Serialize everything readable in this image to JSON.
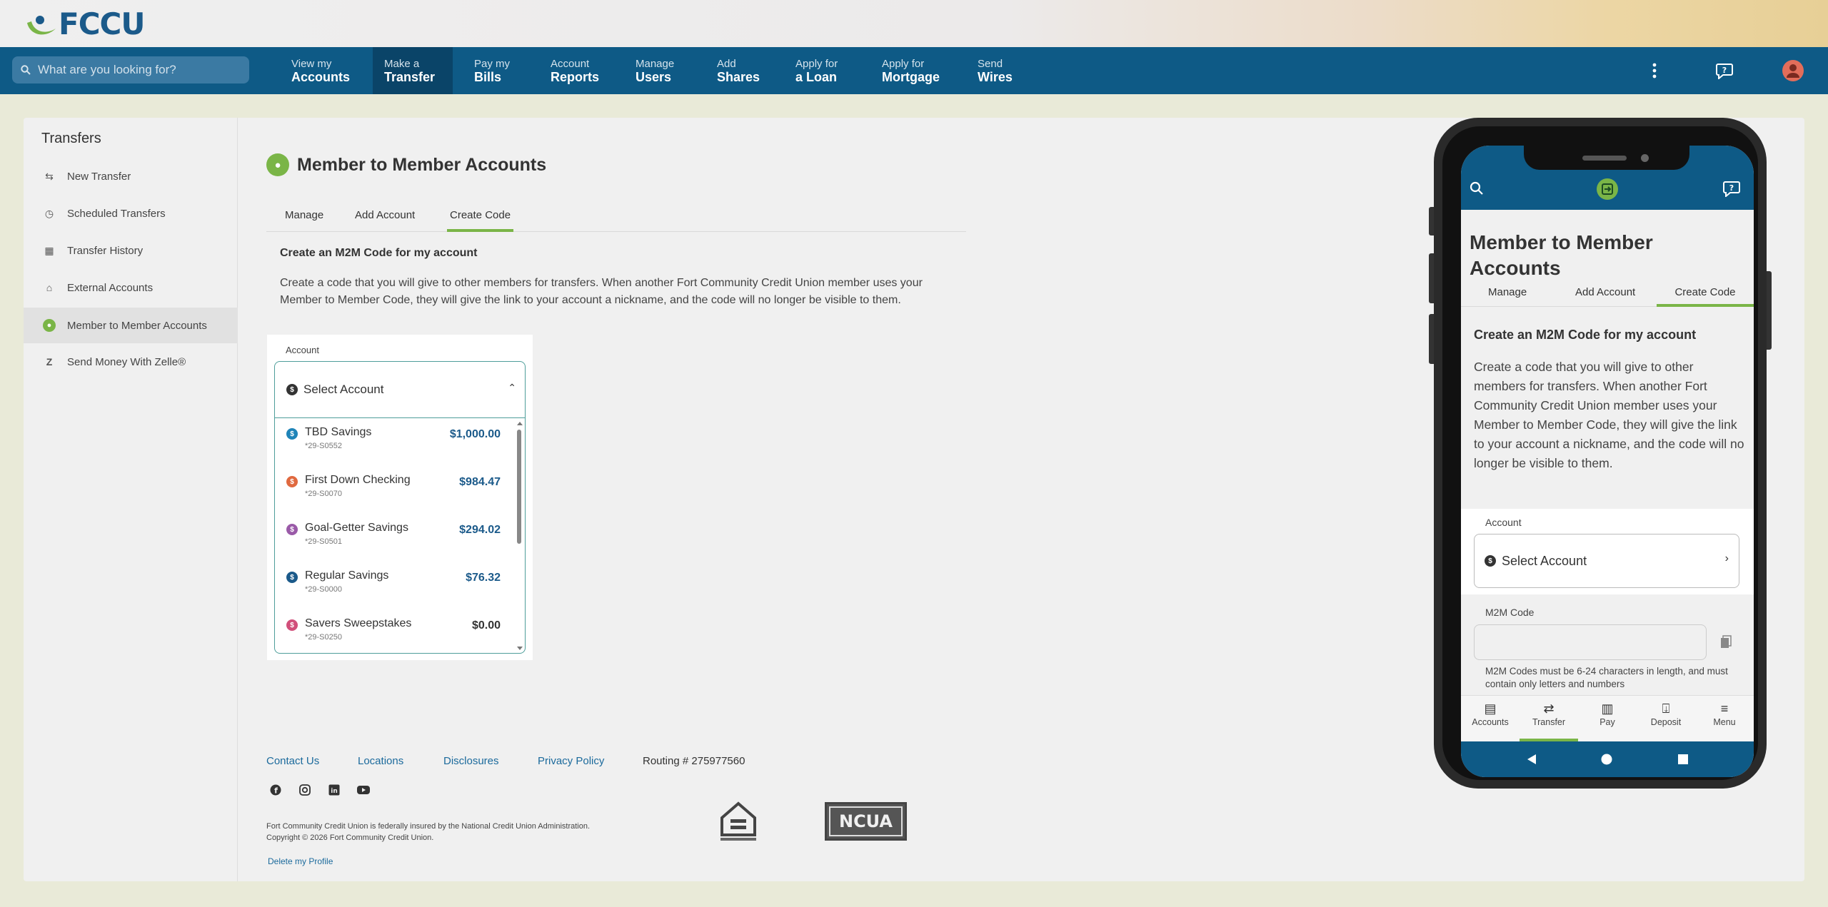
{
  "brand": {
    "name": "FCCU"
  },
  "search": {
    "placeholder": "What are you looking for?"
  },
  "nav": [
    {
      "line1": "View my",
      "line2": "Accounts"
    },
    {
      "line1": "Make a",
      "line2": "Transfer"
    },
    {
      "line1": "Pay my",
      "line2": "Bills"
    },
    {
      "line1": "Account",
      "line2": "Reports"
    },
    {
      "line1": "Manage",
      "line2": "Users"
    },
    {
      "line1": "Add",
      "line2": "Shares"
    },
    {
      "line1": "Apply for",
      "line2": "a Loan"
    },
    {
      "line1": "Apply for",
      "line2": "Mortgage"
    },
    {
      "line1": "Send",
      "line2": "Wires"
    }
  ],
  "sidebar": {
    "title": "Transfers",
    "items": [
      {
        "label": "New Transfer",
        "icon": "arrows-icon"
      },
      {
        "label": "Scheduled Transfers",
        "icon": "clock-icon"
      },
      {
        "label": "Transfer History",
        "icon": "calendar-icon"
      },
      {
        "label": "External Accounts",
        "icon": "bank-icon"
      },
      {
        "label": "Member to Member Accounts",
        "icon": "members-icon"
      },
      {
        "label": "Send Money With Zelle®",
        "icon": "zelle-icon"
      }
    ]
  },
  "page": {
    "title": "Member to Member Accounts",
    "tabs": [
      "Manage",
      "Add Account",
      "Create Code"
    ],
    "section_title": "Create an M2M Code for my account",
    "description": "Create a code that you will give to other members for transfers. When another Fort Community Credit Union member uses your Member to Member Code, they will give the link to your account a nickname, and the code will no longer be visible to them.",
    "account_label": "Account",
    "select_placeholder": "Select Account"
  },
  "accounts": [
    {
      "name": "TBD Savings",
      "number": "*29-S0552",
      "amount": "$1,000.00",
      "color": "#1f84b8"
    },
    {
      "name": "First Down Checking",
      "number": "*29-S0070",
      "amount": "$984.47",
      "color": "#e0693f"
    },
    {
      "name": "Goal-Getter Savings",
      "number": "*29-S0501",
      "amount": "$294.02",
      "color": "#9a5aa8"
    },
    {
      "name": "Regular Savings",
      "number": "*29-S0000",
      "amount": "$76.32",
      "color": "#1b5a8a"
    },
    {
      "name": "Savers Sweepstakes",
      "number": "*29-S0250",
      "amount": "$0.00",
      "color": "#d14f7a"
    }
  ],
  "footer": {
    "links": [
      "Contact Us",
      "Locations",
      "Disclosures",
      "Privacy Policy"
    ],
    "routing": "Routing # 275977560",
    "insured": "Fort Community Credit Union is federally insured by the National Credit Union Administration.",
    "copyright": "Copyright © 2026 Fort Community Credit Union.",
    "delete_profile": "Delete my Profile",
    "ncua": "NCUA"
  },
  "phone": {
    "title": "Member to Member Accounts",
    "tabs": [
      "Manage",
      "Add Account",
      "Create Code"
    ],
    "section_title": "Create an M2M Code for my account",
    "description": "Create a code that you will give to other members for transfers. When another Fort Community Credit Union member uses your Member to Member Code, they will give the link to your account a nickname, and the code will no longer be visible to them.",
    "account_label": "Account",
    "select_placeholder": "Select Account",
    "m2m_label": "M2M Code",
    "m2m_note": "M2M Codes must be 6-24 characters in length, and must contain only letters and numbers",
    "bottom_nav": [
      "Accounts",
      "Transfer",
      "Pay",
      "Deposit",
      "Menu"
    ]
  },
  "colors": {
    "nav_bg": "#0e5a86",
    "accent_green": "#7ab547",
    "link_blue": "#1b6a9c"
  }
}
